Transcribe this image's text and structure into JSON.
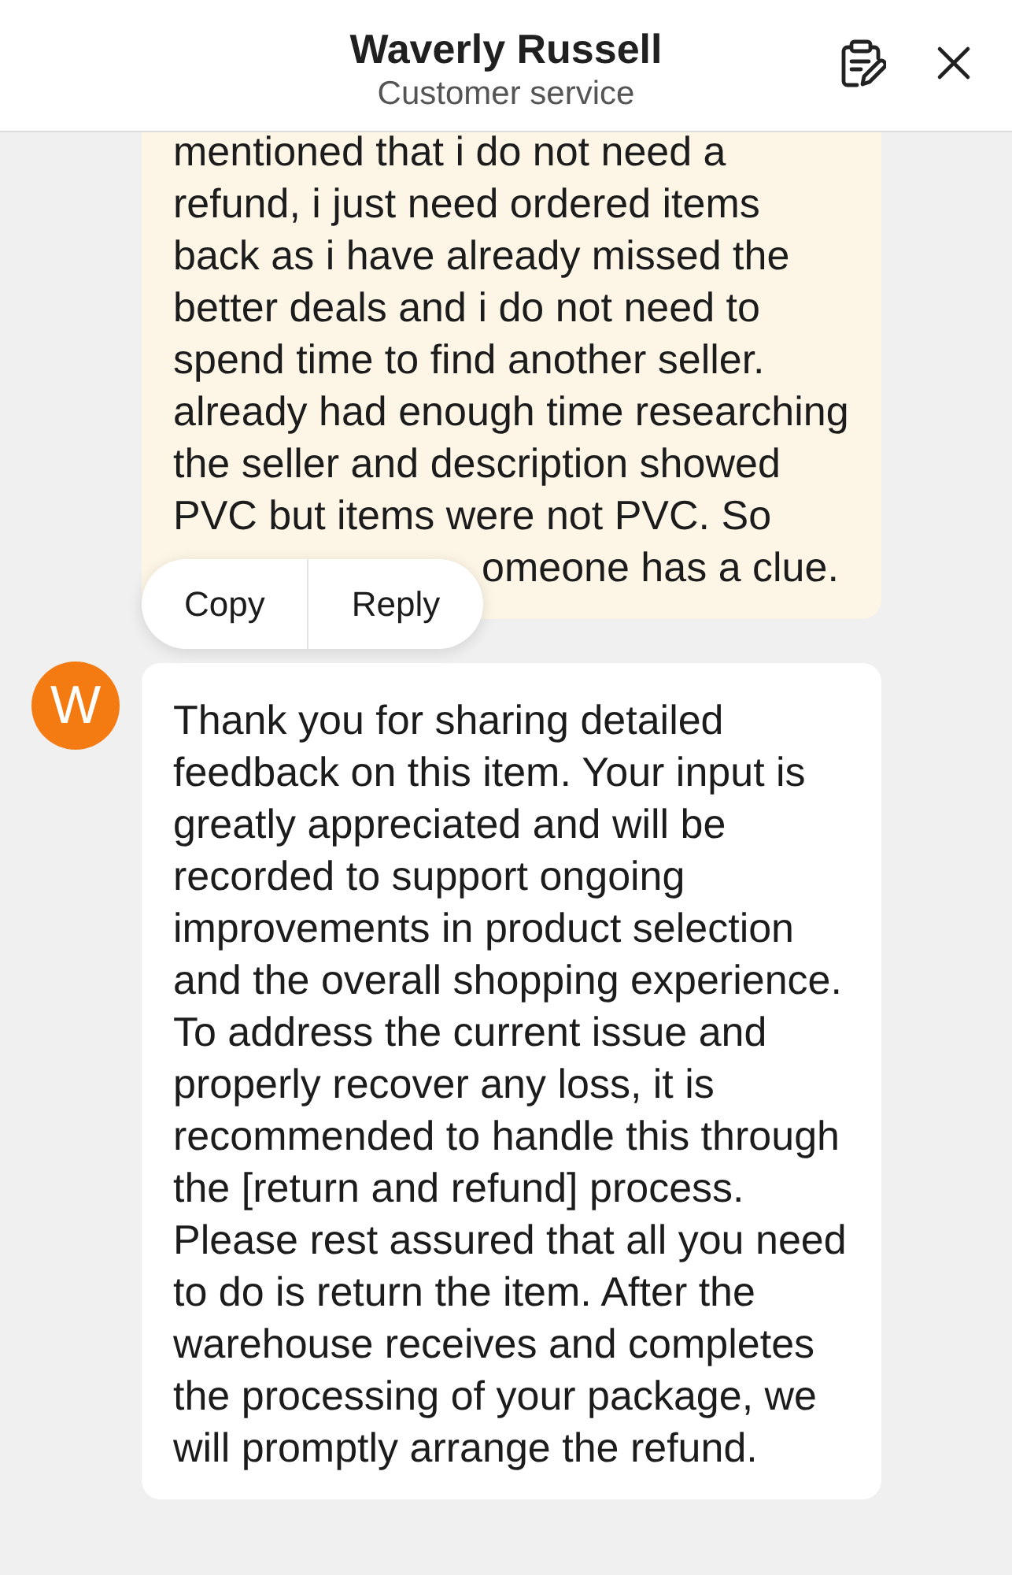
{
  "header": {
    "title": "Waverly Russell",
    "subtitle": "Customer service"
  },
  "messages": [
    {
      "kind": "user",
      "paragraphs": [
        "mentioned that i do not need a refund, i just need ordered items back as i have already missed the better deals and i do not need to spend time to find another seller. already had enough time researching the seller and description showed PVC but items were not PVC. So"
      ],
      "partial_line": "omeone has a clue.",
      "menu": {
        "items": [
          "Copy",
          "Reply"
        ]
      }
    },
    {
      "kind": "agent",
      "avatar": "W",
      "paragraphs": [
        "Thank you for sharing detailed feedback on this item. Your input is greatly appreciated and will be recorded to support ongoing improvements in product selection and the overall shopping experience. To address the current issue and properly recover any loss, it is recommended to handle this through the [return and refund] process.",
        "Please rest assured that all you need to do is return the item. After the warehouse receives and completes the processing of your package, we will promptly arrange the refund."
      ]
    }
  ]
}
